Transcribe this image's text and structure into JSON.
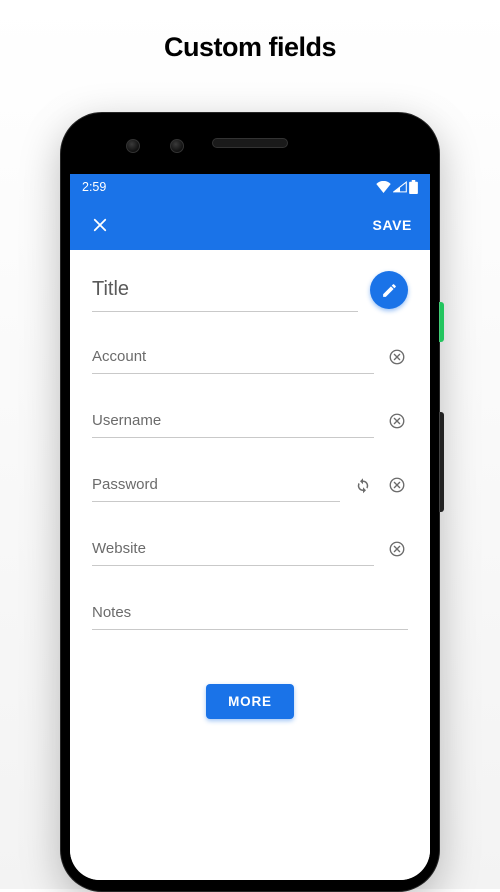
{
  "page": {
    "heading": "Custom fields"
  },
  "status_bar": {
    "time": "2:59"
  },
  "app_bar": {
    "save_label": "SAVE"
  },
  "form": {
    "title_placeholder": "Title",
    "fields": {
      "account": {
        "placeholder": "Account"
      },
      "username": {
        "placeholder": "Username"
      },
      "password": {
        "placeholder": "Password"
      },
      "website": {
        "placeholder": "Website"
      },
      "notes": {
        "placeholder": "Notes"
      }
    },
    "more_label": "MORE"
  }
}
